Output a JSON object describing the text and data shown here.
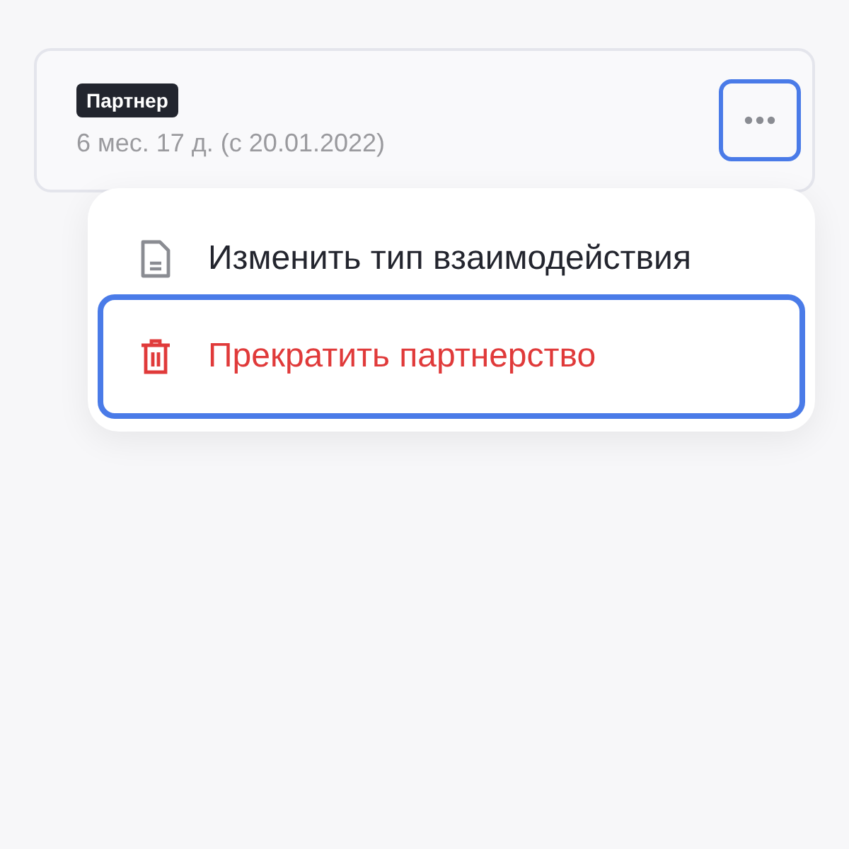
{
  "card": {
    "badge": "Партнер",
    "duration": "6 мес. 17 д. (с 20.01.2022)",
    "more_button": {
      "focused": true
    }
  },
  "menu": {
    "items": [
      {
        "kind": "document",
        "label": "Изменить тип взаимодействия",
        "focused": false
      },
      {
        "kind": "danger",
        "label": "Прекратить партнерство",
        "focused": true
      }
    ]
  }
}
